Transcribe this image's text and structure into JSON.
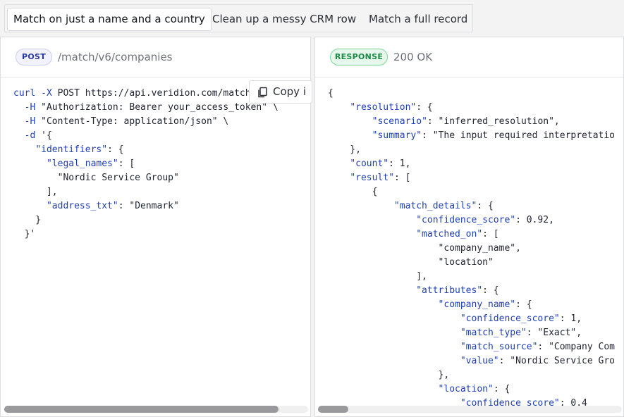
{
  "tabs": [
    {
      "label": "Match on just a name and a country",
      "active": true
    },
    {
      "label": "Clean up a messy CRM row",
      "active": false
    },
    {
      "label": "Match a full record",
      "active": false
    }
  ],
  "request": {
    "method": "POST",
    "path": "/match/v6/companies",
    "copy_label": "Copy i",
    "code_lines": [
      "curl -X POST https://api.veridion.com/match",
      "  -H \"Authorization: Bearer your_access_token\" \\",
      "  -H \"Content-Type: application/json\" \\",
      "  -d '{",
      "    \"identifiers\": {",
      "      \"legal_names\": [",
      "        \"Nordic Service Group\"",
      "      ],",
      "      \"address_txt\": \"Denmark\"",
      "    }",
      "  }'"
    ]
  },
  "response": {
    "badge": "RESPONSE",
    "status": "200 OK",
    "code_lines": [
      "{",
      "    \"resolution\": {",
      "        \"scenario\": \"inferred_resolution\",",
      "        \"summary\": \"The input required interpretatio",
      "    },",
      "    \"count\": 1,",
      "    \"result\": [",
      "        {",
      "            \"match_details\": {",
      "                \"confidence_score\": 0.92,",
      "                \"matched_on\": [",
      "                    \"company_name\",",
      "                    \"location\"",
      "                ],",
      "                \"attributes\": {",
      "                    \"company_name\": {",
      "                        \"confidence_score\": 1,",
      "                        \"match_type\": \"Exact\",",
      "                        \"match_source\": \"Company Com",
      "                        \"value\": \"Nordic Service Gro",
      "                    },",
      "                    \"location\": {",
      "                        \"confidence_score\": 0.4"
    ]
  },
  "colors": {
    "post_badge": "#2d3a9c",
    "response_badge": "#1d8a47",
    "code_keyword": "#1f3fb3"
  },
  "icons": {
    "copy": "copy-icon"
  }
}
